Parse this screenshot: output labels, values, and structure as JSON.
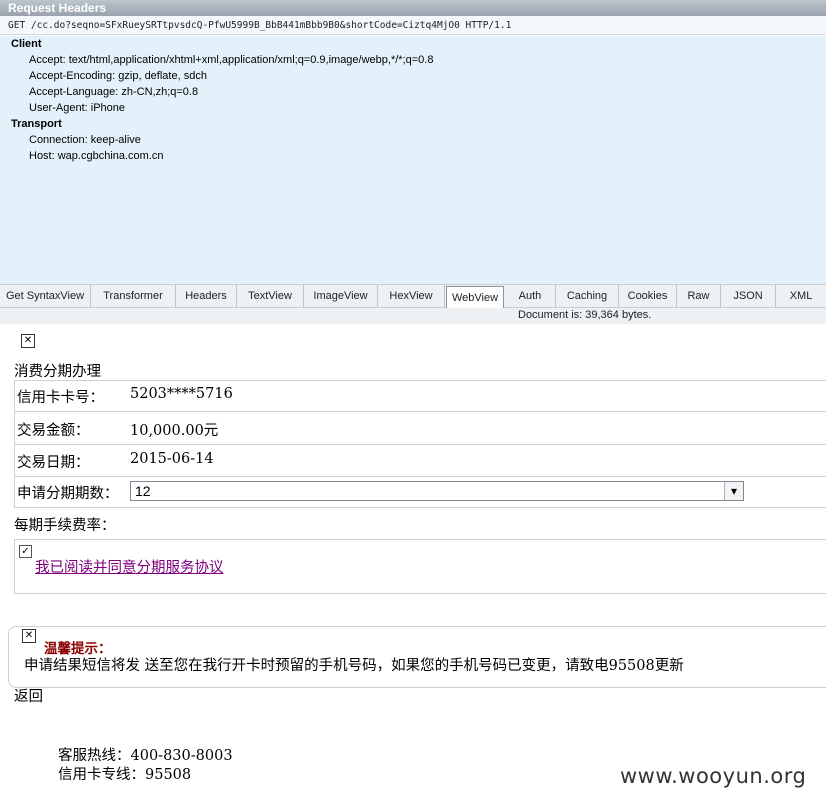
{
  "request": {
    "title": "Request Headers",
    "request_line": "GET /cc.do?seqno=SFxRueySRTtpvsdcQ-PfwU5999B_BbB441mBbb9B0&shortCode=Ciztq4MjO0 HTTP/1.1",
    "groups": [
      {
        "name": "Client",
        "headers": [
          "Accept: text/html,application/xhtml+xml,application/xml;q=0.9,image/webp,*/*;q=0.8",
          "Accept-Encoding: gzip, deflate, sdch",
          "Accept-Language: zh-CN,zh;q=0.8",
          "User-Agent: iPhone"
        ]
      },
      {
        "name": "Transport",
        "headers": [
          "Connection: keep-alive",
          "Host: wap.cgbchina.com.cn"
        ]
      }
    ]
  },
  "tabs": [
    {
      "label": "Get SyntaxView"
    },
    {
      "label": "Transformer"
    },
    {
      "label": "Headers"
    },
    {
      "label": "TextView"
    },
    {
      "label": "ImageView"
    },
    {
      "label": "HexView"
    },
    {
      "label": "WebView"
    },
    {
      "label": "Auth"
    },
    {
      "label": "Caching"
    },
    {
      "label": "Cookies"
    },
    {
      "label": "Raw"
    },
    {
      "label": "JSON"
    },
    {
      "label": "XML"
    }
  ],
  "selected_tab": "WebView",
  "document_info": "Document is: 39,364 bytes.",
  "webview": {
    "heading": "消费分期办理",
    "rows": [
      {
        "label": "信用卡卡号：",
        "value": "5203****5716"
      },
      {
        "label": "交易金额：",
        "value": "10,000.00元"
      },
      {
        "label": "交易日期：",
        "value": "2015-06-14"
      }
    ],
    "installments_label": "申请分期期数：",
    "installments_value": "12",
    "fee_label": "每期手续费率：",
    "agree_checked": true,
    "agree_link": "我已阅读并同意分期服务协议",
    "tip_title": "温馨提示：",
    "tip_text": "申请结果短信将发 送至您在我行开卡时预留的手机号码，如果您的手机号码已变更，请致电95508更新",
    "back": "返回",
    "hotline": "客服热线：400-830-8003",
    "card_line": "信用卡专线：95508"
  },
  "watermark": "www.wooyun.org",
  "colors": {
    "panel_bg": "#e3f1fb",
    "tip_title": "#8b0000",
    "link_visited": "#800080"
  }
}
